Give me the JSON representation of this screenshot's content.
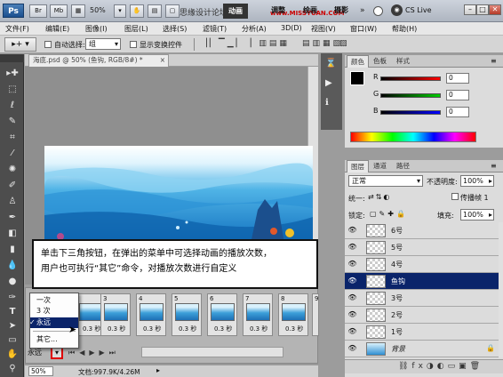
{
  "titlebar": {
    "app_icon": "Ps",
    "zoom": "50%",
    "watermark": "思缘设计论坛",
    "website": "www.MISSYUAN.COM",
    "workspaces": [
      "调整",
      "绘画",
      "摄影"
    ],
    "active_workspace": "动画",
    "cs_live": "CS Live",
    "min": "–",
    "max": "□",
    "close": "✕"
  },
  "menubar": {
    "items": [
      "文件(F)",
      "编辑(E)",
      "图像(I)",
      "图层(L)",
      "选择(S)",
      "滤镜(T)",
      "分析(A)",
      "3D(D)",
      "视图(V)",
      "窗口(W)",
      "帮助(H)"
    ]
  },
  "options": {
    "auto_select": "自动选择:",
    "group": "组",
    "show_transform": "显示变换控件"
  },
  "document": {
    "tab_title": "海底.psd @ 50% (鱼钩, RGB/8#) *",
    "tab_close": "×"
  },
  "callout": {
    "line1": "单击下三角按钮，在弹出的菜单中可选择动画的播放次数，",
    "line2": "用户也可执行“其它”命令，对播放次数进行自定义"
  },
  "animation": {
    "frames": [
      {
        "num": "3",
        "dur": "0.3 秒"
      },
      {
        "num": "4",
        "dur": "0.3 秒"
      },
      {
        "num": "5",
        "dur": "0.3 秒"
      },
      {
        "num": "6",
        "dur": "0.3 秒"
      },
      {
        "num": "7",
        "dur": "0.3 秒"
      },
      {
        "num": "8",
        "dur": "0.3 秒"
      },
      {
        "num": "9",
        "dur": "0.3 秒"
      }
    ],
    "partial_frame": {
      "dur": "0.3 秒"
    },
    "loop_value": "永远",
    "loop_menu": [
      {
        "label": "一次",
        "checked": false
      },
      {
        "label": "3 次",
        "checked": false
      },
      {
        "label": "永远",
        "checked": true
      },
      {
        "label": "其它...",
        "checked": false
      }
    ],
    "checkmark": "✓"
  },
  "status": {
    "zoom": "50%",
    "doc_info": "文档:997.9K/4.26M"
  },
  "color_panel": {
    "tabs": [
      "颜色",
      "色板",
      "样式"
    ],
    "channels": [
      {
        "label": "R",
        "value": "0"
      },
      {
        "label": "G",
        "value": "0"
      },
      {
        "label": "B",
        "value": "0"
      }
    ]
  },
  "layers_panel": {
    "tabs": [
      "图层",
      "通道",
      "路径"
    ],
    "blend_mode": "正常",
    "opacity_label": "不透明度:",
    "opacity_value": "100%",
    "unify_label": "统一:",
    "propagate_label": "传播帧 1",
    "lock_label": "锁定:",
    "fill_label": "填充:",
    "fill_value": "100%",
    "layers": [
      {
        "name": "6号",
        "selected": false
      },
      {
        "name": "5号",
        "selected": false
      },
      {
        "name": "4号",
        "selected": false
      },
      {
        "name": "鱼钩",
        "selected": true
      },
      {
        "name": "3号",
        "selected": false
      },
      {
        "name": "2号",
        "selected": false
      },
      {
        "name": "1号",
        "selected": false
      },
      {
        "name": "背景",
        "selected": false
      }
    ]
  },
  "colors": {
    "selection": "#0a246a",
    "highlight_red": "#e00000"
  }
}
